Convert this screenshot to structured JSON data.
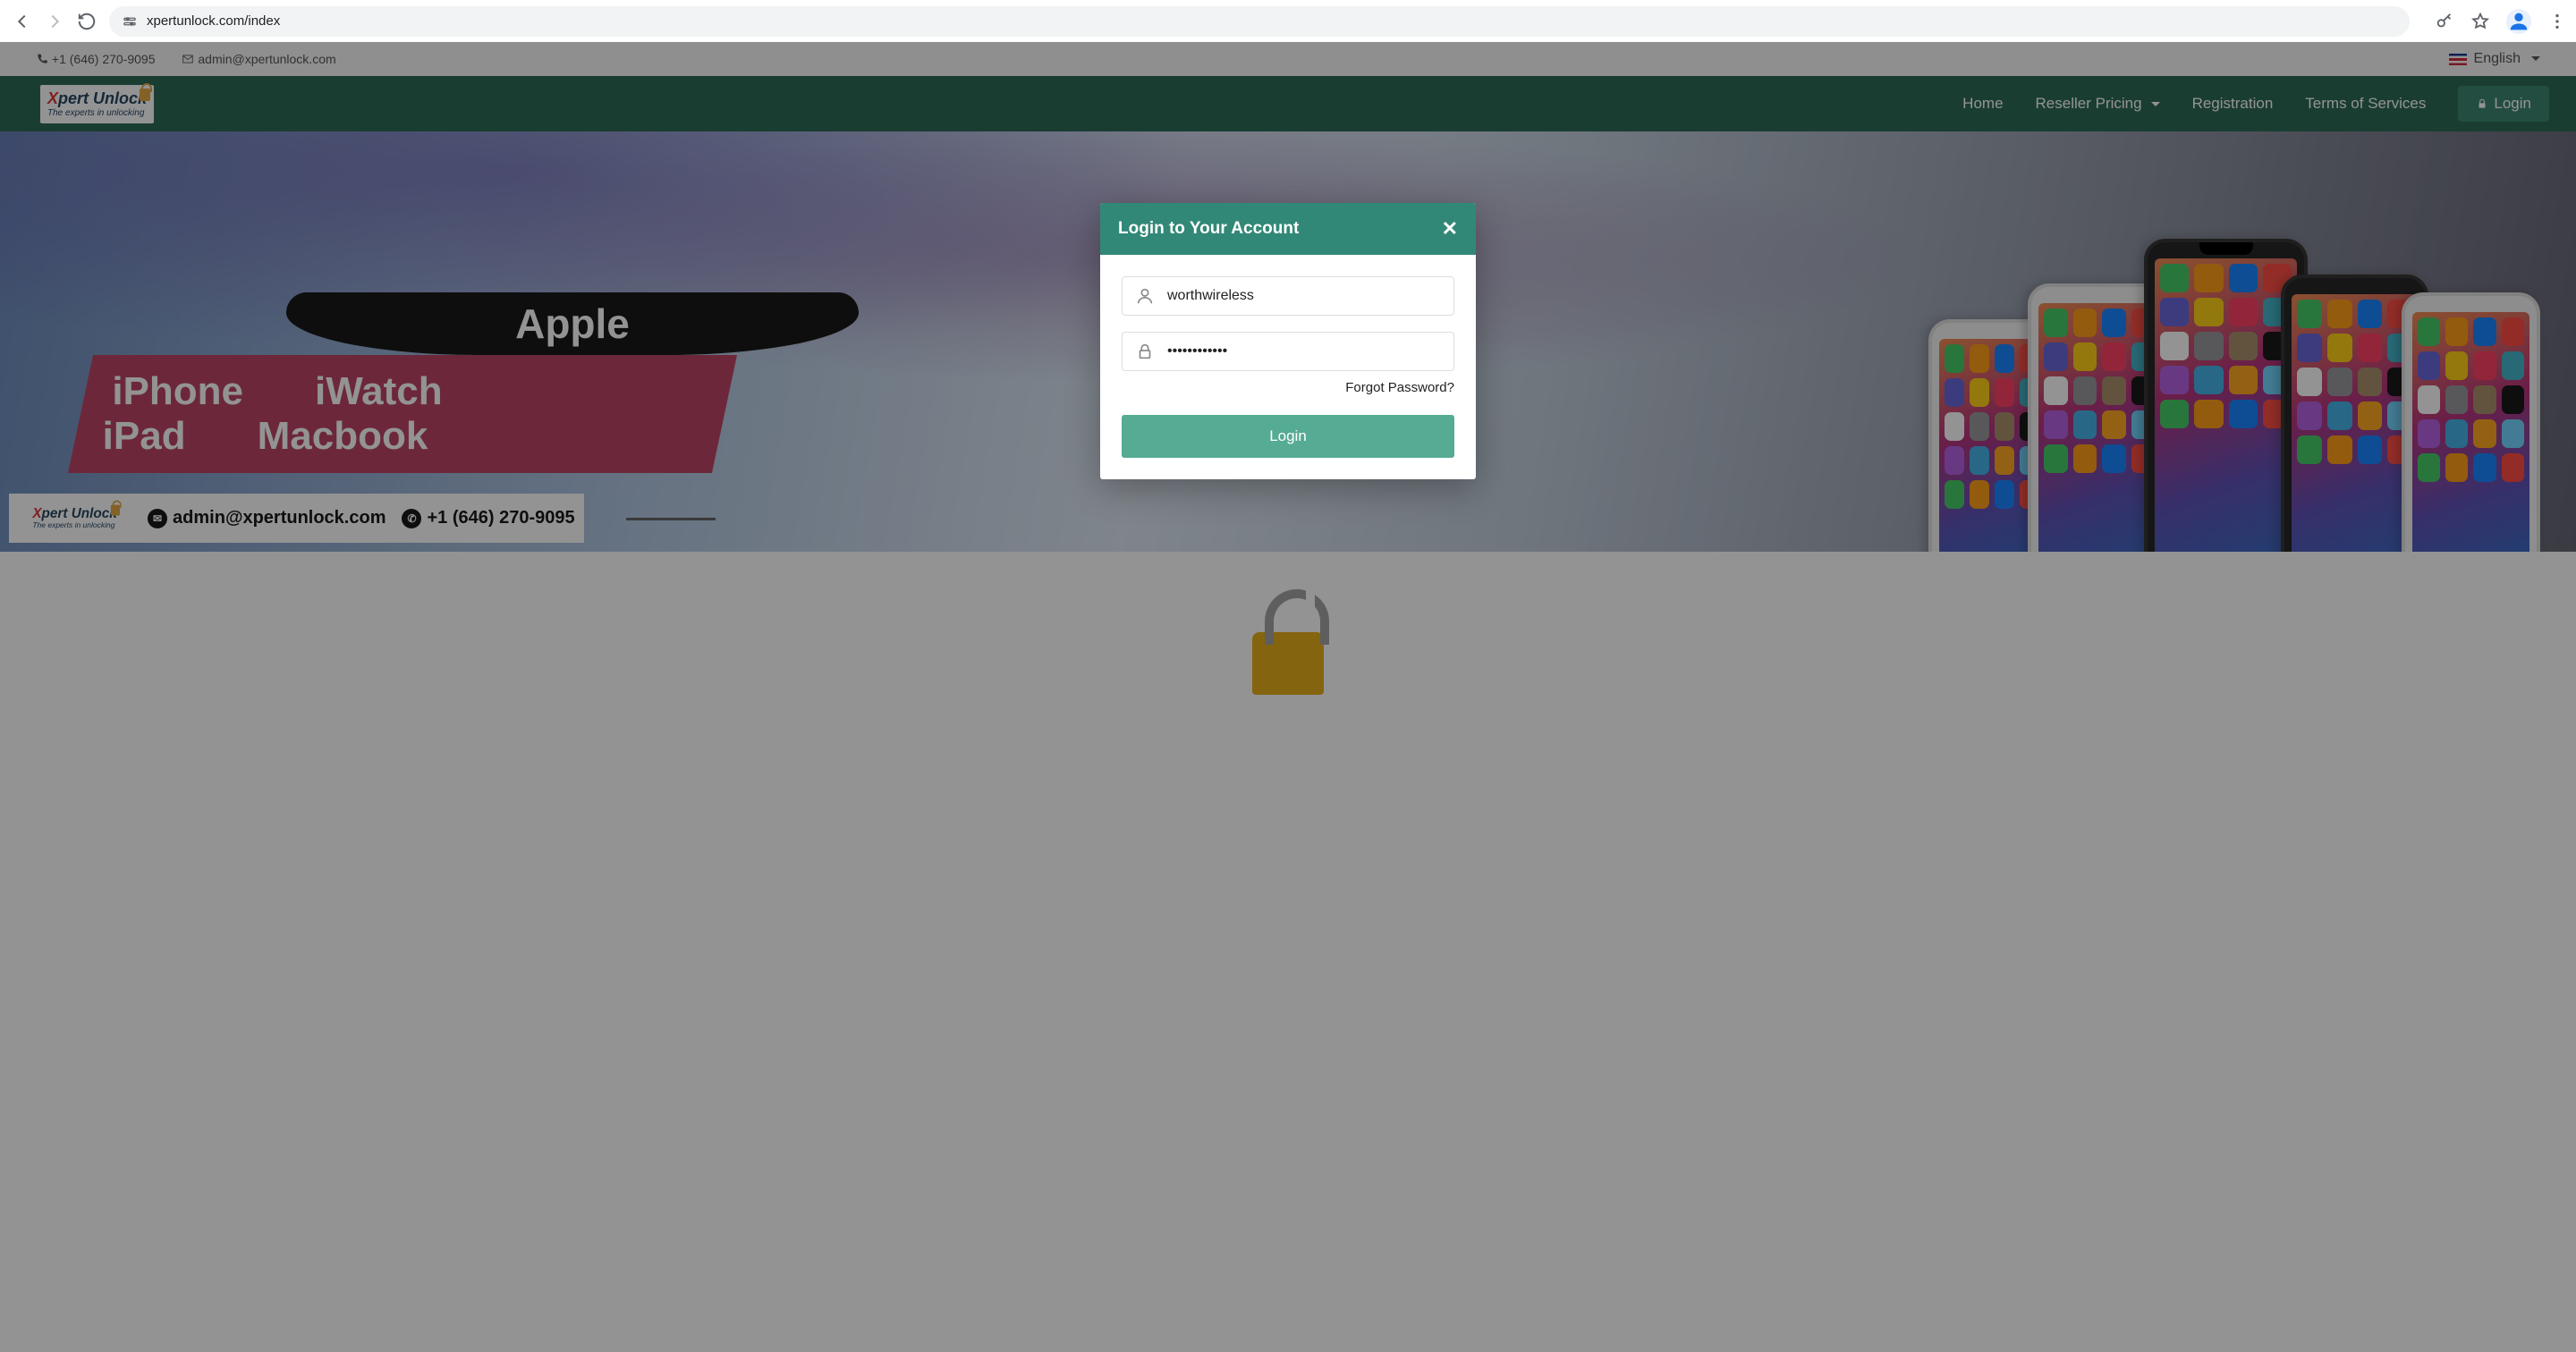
{
  "browser": {
    "url": "xpertunlock.com/index"
  },
  "topbar": {
    "phone": "+1 (646) 270-9095",
    "email": "admin@xpertunlock.com",
    "language": "English"
  },
  "logo": {
    "brand_prefix": "X",
    "brand_main": "pert Unlock",
    "tagline": "The experts in unlocking"
  },
  "nav": {
    "home": "Home",
    "reseller": "Reseller Pricing",
    "registration": "Registration",
    "tos": "Terms of Services",
    "login": "Login"
  },
  "hero": {
    "headline": "Apple",
    "grid": {
      "r1c1": "iPhone",
      "r1c2": "iWatch",
      "r2c1": "iPad",
      "r2c2": "Macbook"
    },
    "contact_email": "admin@xpertunlock.com",
    "contact_phone": "+1 (646) 270-9095"
  },
  "modal": {
    "title": "Login to Your Account",
    "username_value": "worthwireless",
    "password_value": "••••••••••••",
    "forgot": "Forgot Password?",
    "submit": "Login"
  },
  "phone_app_colors": [
    "#34c759",
    "#ff9500",
    "#007aff",
    "#ff3b30",
    "#5856d6",
    "#ffcc00",
    "#ff2d55",
    "#30b0c7",
    "#fff",
    "#8e8e93",
    "#a2845e",
    "#000",
    "#af52de",
    "#32ade6",
    "#ff9f0a",
    "#64d2ff"
  ]
}
